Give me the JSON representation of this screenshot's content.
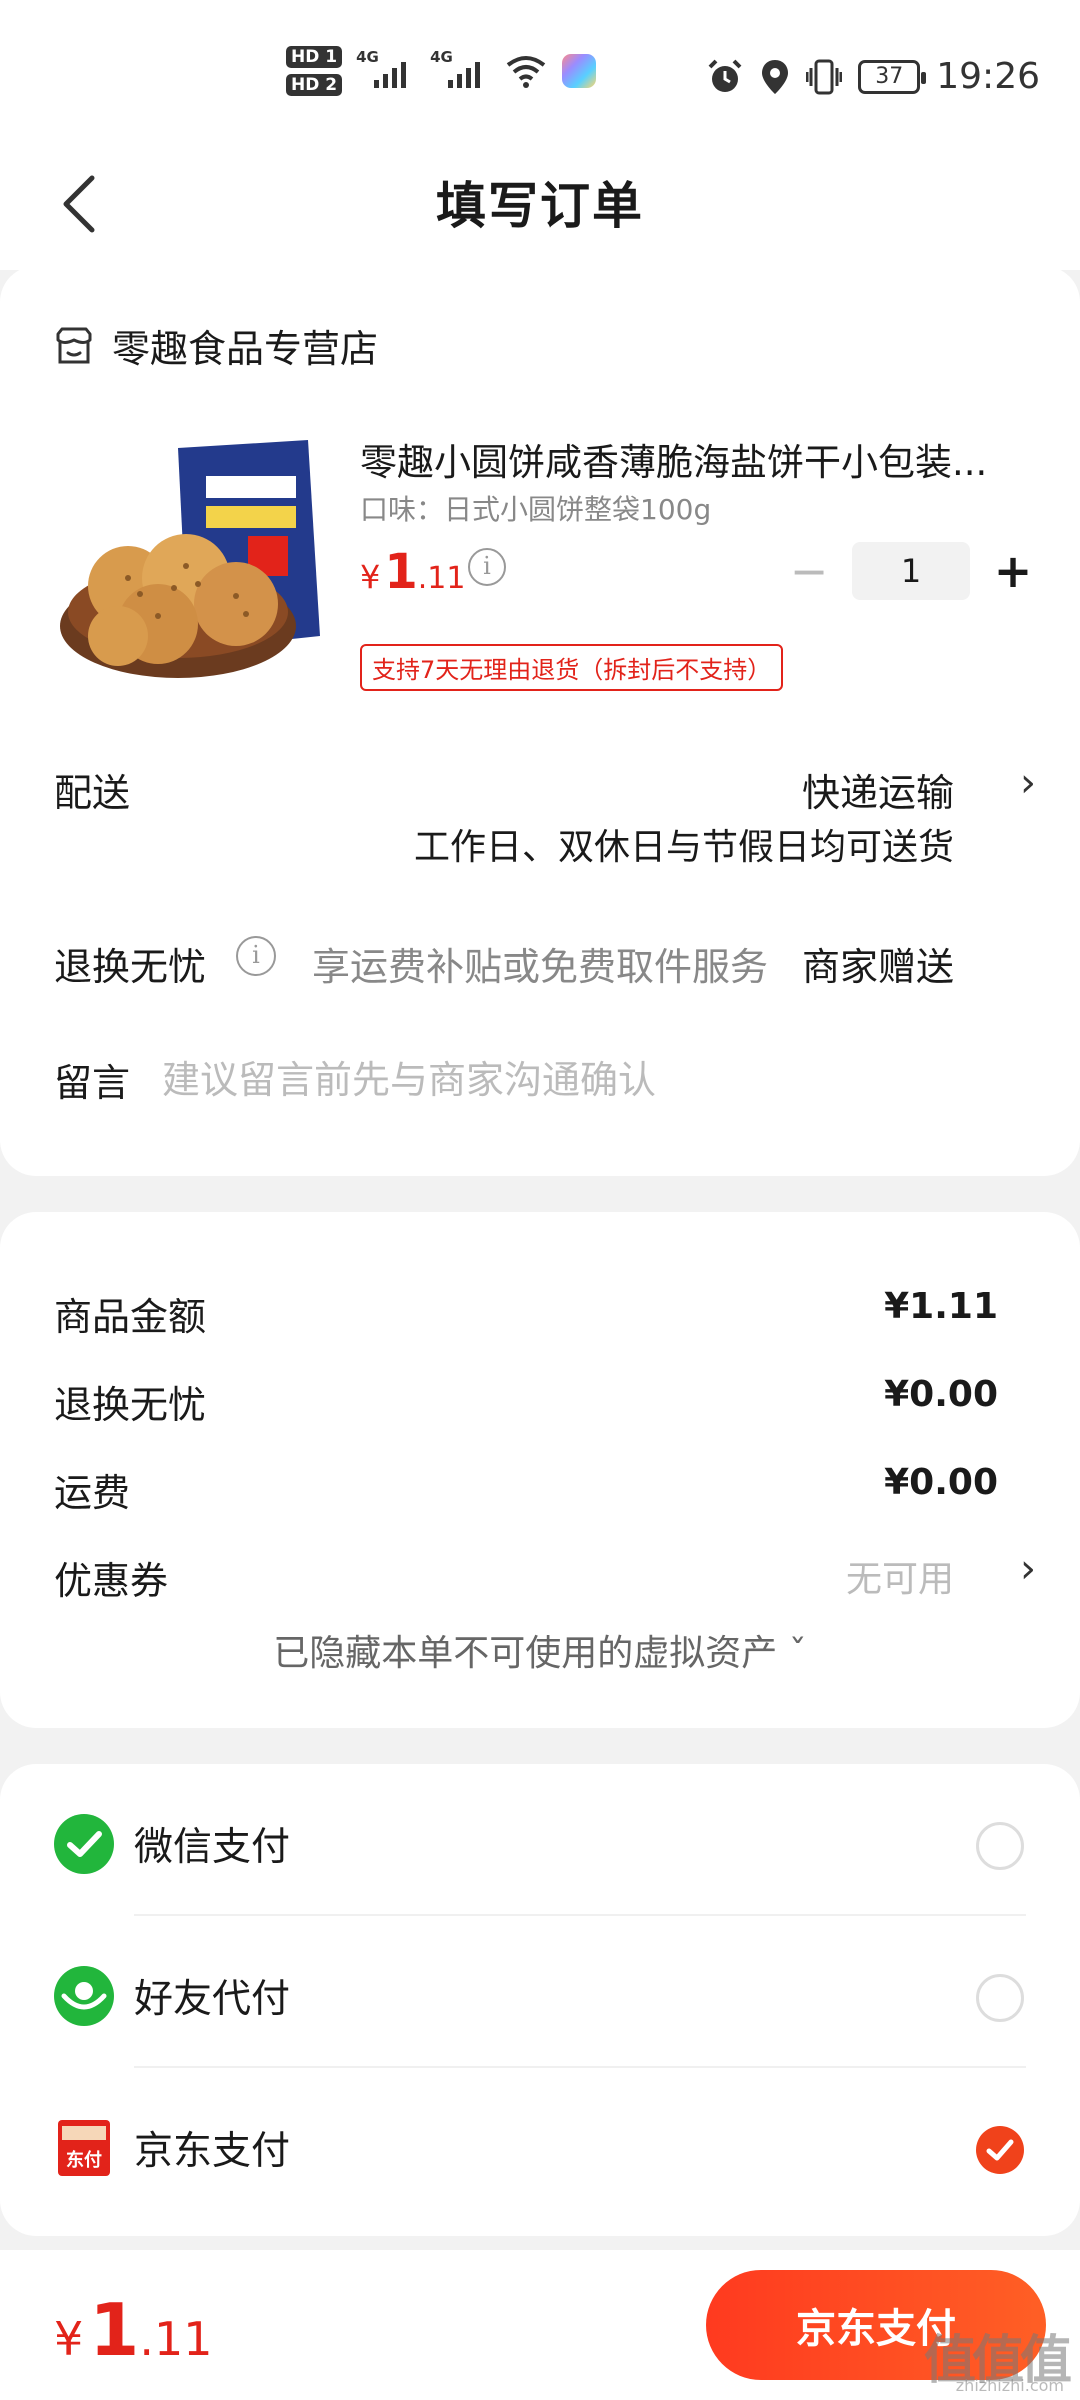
{
  "status_bar": {
    "hd1": "HD 1",
    "hd2": "HD 2",
    "net1": "4G",
    "net2": "4G",
    "battery": "37",
    "time": "19:26"
  },
  "nav": {
    "title": "填写订单"
  },
  "store": {
    "name": "零趣食品专营店",
    "icon": "store-icon"
  },
  "product": {
    "name": "零趣小圆饼咸香薄脆海盐饼干小包装...",
    "spec": "口味：日式小圆饼整袋100g",
    "price_currency": "¥",
    "price_int": "1",
    "price_dec": ".11",
    "quantity": "1",
    "minus": "−",
    "plus": "+",
    "return_policy": "支持7天无理由退货（拆封后不支持）"
  },
  "delivery": {
    "label": "配送",
    "method": "快递运输",
    "note": "工作日、双休日与节假日均可送货"
  },
  "worry_free": {
    "label": "退换无忧",
    "desc": "享运费补贴或免费取件服务",
    "value": "商家赠送"
  },
  "message": {
    "label": "留言",
    "placeholder": "建议留言前先与商家沟通确认",
    "value": ""
  },
  "summary": {
    "items": [
      {
        "label": "商品金额",
        "value": "¥1.11"
      },
      {
        "label": "退换无忧",
        "value": "¥0.00"
      },
      {
        "label": "运费",
        "value": "¥0.00"
      }
    ],
    "coupon_label": "优惠券",
    "coupon_value": "无可用",
    "hidden_assets": "已隐藏本单不可使用的虚拟资产 ˇ"
  },
  "payment": {
    "methods": [
      {
        "label": "微信支付",
        "icon": "wechat-pay-icon",
        "selected": false
      },
      {
        "label": "好友代付",
        "icon": "friend-pay-icon",
        "selected": false
      },
      {
        "label": "京东支付",
        "icon": "jd-pay-icon",
        "selected": true
      }
    ]
  },
  "footer": {
    "currency": "¥",
    "total_int": "1",
    "total_dec": ".11",
    "pay_button": "京东支付"
  },
  "watermark": {
    "text": "值值值",
    "sub": "zhizhizhi.com"
  },
  "colors": {
    "accent": "#e2231a",
    "button": "#ff3a1f",
    "wechat": "#22b63c"
  }
}
